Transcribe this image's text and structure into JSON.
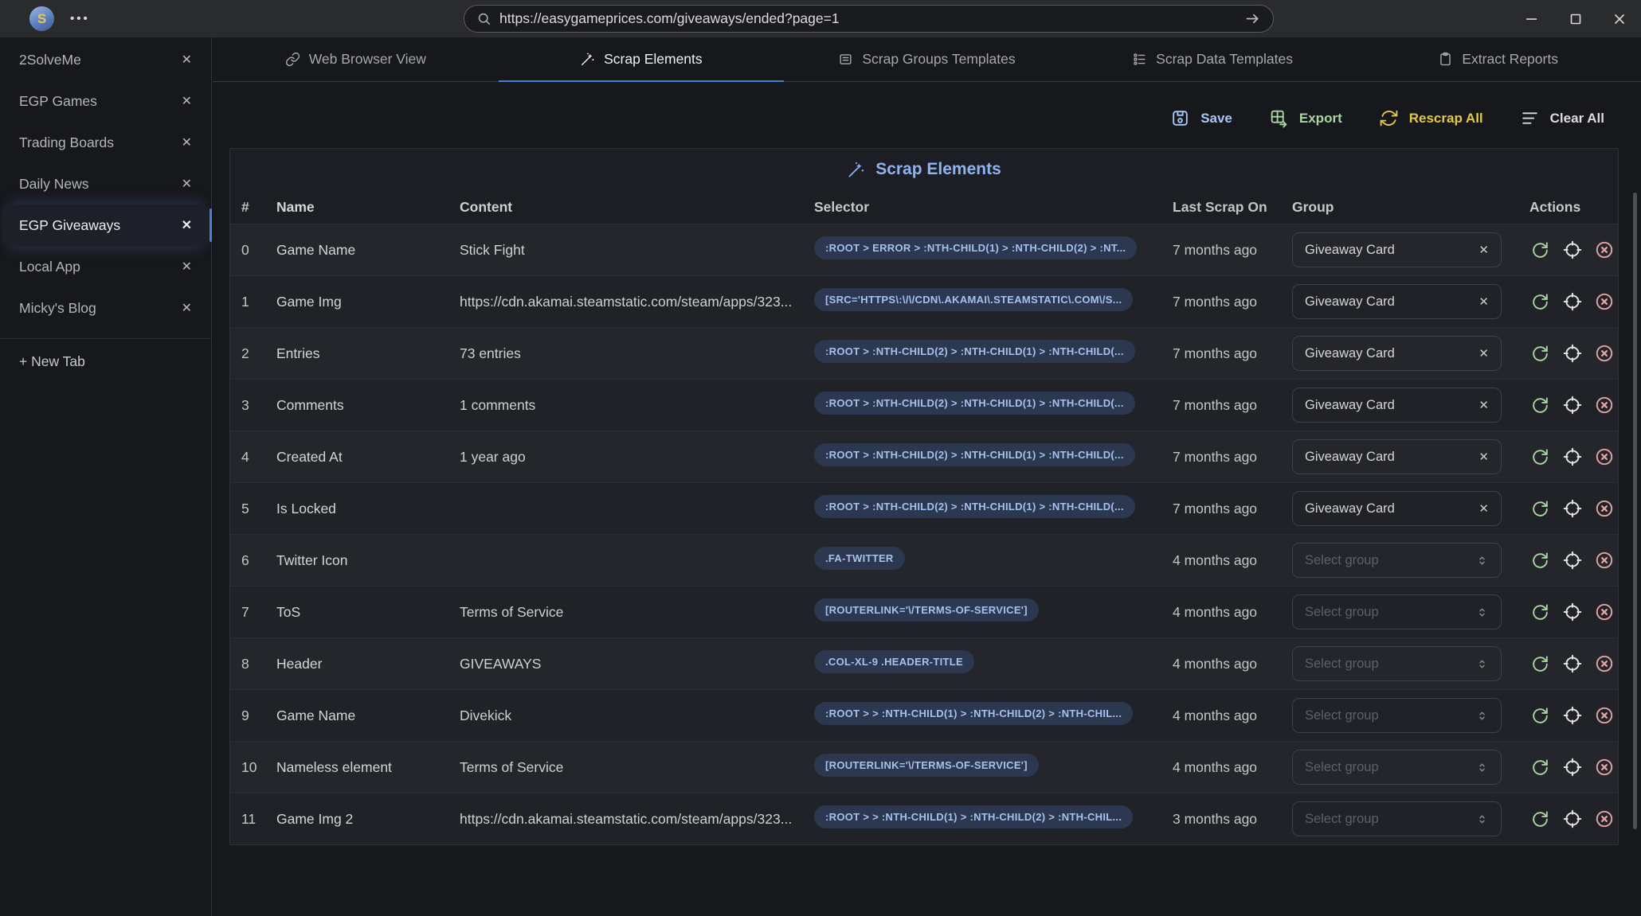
{
  "window": {
    "logo_letter": "S",
    "menu_dots": "•••",
    "url": "https://easygameprices.com/giveaways/ended?page=1"
  },
  "sidebar": {
    "tabs": [
      {
        "label": "2SolveMe",
        "active": false
      },
      {
        "label": "EGP Games",
        "active": false
      },
      {
        "label": "Trading Boards",
        "active": false
      },
      {
        "label": "Daily News",
        "active": false
      },
      {
        "label": "EGP Giveaways",
        "active": true
      },
      {
        "label": "Local App",
        "active": false
      },
      {
        "label": "Micky's Blog",
        "active": false
      }
    ],
    "new_tab_label": "+ New Tab"
  },
  "tabs": [
    {
      "label": "Web Browser View",
      "icon": "link-icon",
      "active": false
    },
    {
      "label": "Scrap Elements",
      "icon": "wand-icon",
      "active": true
    },
    {
      "label": "Scrap Groups Templates",
      "icon": "groups-icon",
      "active": false
    },
    {
      "label": "Scrap Data Templates",
      "icon": "data-icon",
      "active": false
    },
    {
      "label": "Extract Reports",
      "icon": "report-icon",
      "active": false
    }
  ],
  "toolbar": {
    "buttons": [
      {
        "label": "Save",
        "icon": "save-icon",
        "color": "#a6c8fa"
      },
      {
        "label": "Export",
        "icon": "export-icon",
        "color": "#a9d7a0"
      },
      {
        "label": "Rescrap All",
        "icon": "rescrap-icon",
        "color": "#e5c93f"
      },
      {
        "label": "Clear All",
        "icon": "clear-icon",
        "color": "#dcdde0"
      }
    ]
  },
  "table": {
    "title": "Scrap Elements",
    "title_icon": "wand-icon",
    "columns": [
      "#",
      "Name",
      "Content",
      "Selector",
      "Last Scrap On",
      "Group",
      "Actions"
    ],
    "group_placeholder": "Select group",
    "rows": [
      {
        "index": "0",
        "name": "Game Name",
        "content": "Stick Fight",
        "selector": ":ROOT > ERROR > :NTH-CHILD(1) > :NTH-CHILD(2) > :NT...",
        "last_scrap": "7 months ago",
        "group": "Giveaway Card"
      },
      {
        "index": "1",
        "name": "Game Img",
        "content": "https://cdn.akamai.steamstatic.com/steam/apps/323...",
        "selector": "[SRC='HTTPS\\:\\/\\/CDN\\.AKAMAI\\.STEAMSTATIC\\.COM\\/S...",
        "last_scrap": "7 months ago",
        "group": "Giveaway Card"
      },
      {
        "index": "2",
        "name": "Entries",
        "content": "73 entries",
        "selector": ":ROOT > :NTH-CHILD(2) > :NTH-CHILD(1) > :NTH-CHILD(...",
        "last_scrap": "7 months ago",
        "group": "Giveaway Card"
      },
      {
        "index": "3",
        "name": "Comments",
        "content": "1 comments",
        "selector": ":ROOT > :NTH-CHILD(2) > :NTH-CHILD(1) > :NTH-CHILD(...",
        "last_scrap": "7 months ago",
        "group": "Giveaway Card"
      },
      {
        "index": "4",
        "name": "Created At",
        "content": "1 year ago",
        "selector": ":ROOT > :NTH-CHILD(2) > :NTH-CHILD(1) > :NTH-CHILD(...",
        "last_scrap": "7 months ago",
        "group": "Giveaway Card"
      },
      {
        "index": "5",
        "name": "Is Locked",
        "content": "",
        "selector": ":ROOT > :NTH-CHILD(2) > :NTH-CHILD(1) > :NTH-CHILD(...",
        "last_scrap": "7 months ago",
        "group": "Giveaway Card"
      },
      {
        "index": "6",
        "name": "Twitter Icon",
        "content": "",
        "selector": ".FA-TWITTER",
        "last_scrap": "4 months ago",
        "group": null
      },
      {
        "index": "7",
        "name": "ToS",
        "content": "Terms of Service",
        "selector": "[ROUTERLINK='\\/TERMS-OF-SERVICE']",
        "last_scrap": "4 months ago",
        "group": null
      },
      {
        "index": "8",
        "name": "Header",
        "content": "GIVEAWAYS",
        "selector": ".COL-XL-9 .HEADER-TITLE",
        "last_scrap": "4 months ago",
        "group": null
      },
      {
        "index": "9",
        "name": "Game Name",
        "content": "Divekick",
        "selector": ":ROOT > > :NTH-CHILD(1) > :NTH-CHILD(2) > :NTH-CHIL...",
        "last_scrap": "4 months ago",
        "group": null
      },
      {
        "index": "10",
        "name": "Nameless element",
        "content": "Terms of Service",
        "selector": "[ROUTERLINK='\\/TERMS-OF-SERVICE']",
        "last_scrap": "4 months ago",
        "group": null
      },
      {
        "index": "11",
        "name": "Game Img 2",
        "content": "https://cdn.akamai.steamstatic.com/steam/apps/323...",
        "selector": ":ROOT > > :NTH-CHILD(1) > :NTH-CHILD(2) > :NTH-CHIL...",
        "last_scrap": "3 months ago",
        "group": null
      }
    ]
  },
  "colors": {
    "accent_blue": "#4b7fd6",
    "title_blue": "#8fb3ee",
    "badge_bg": "#2c3850",
    "badge_text": "#a7c1ee",
    "save_blue": "#a6c8fa",
    "export_green": "#a9d7a0",
    "rescrap_yellow": "#e5c93f",
    "remove_red": "#dfa3a3"
  }
}
